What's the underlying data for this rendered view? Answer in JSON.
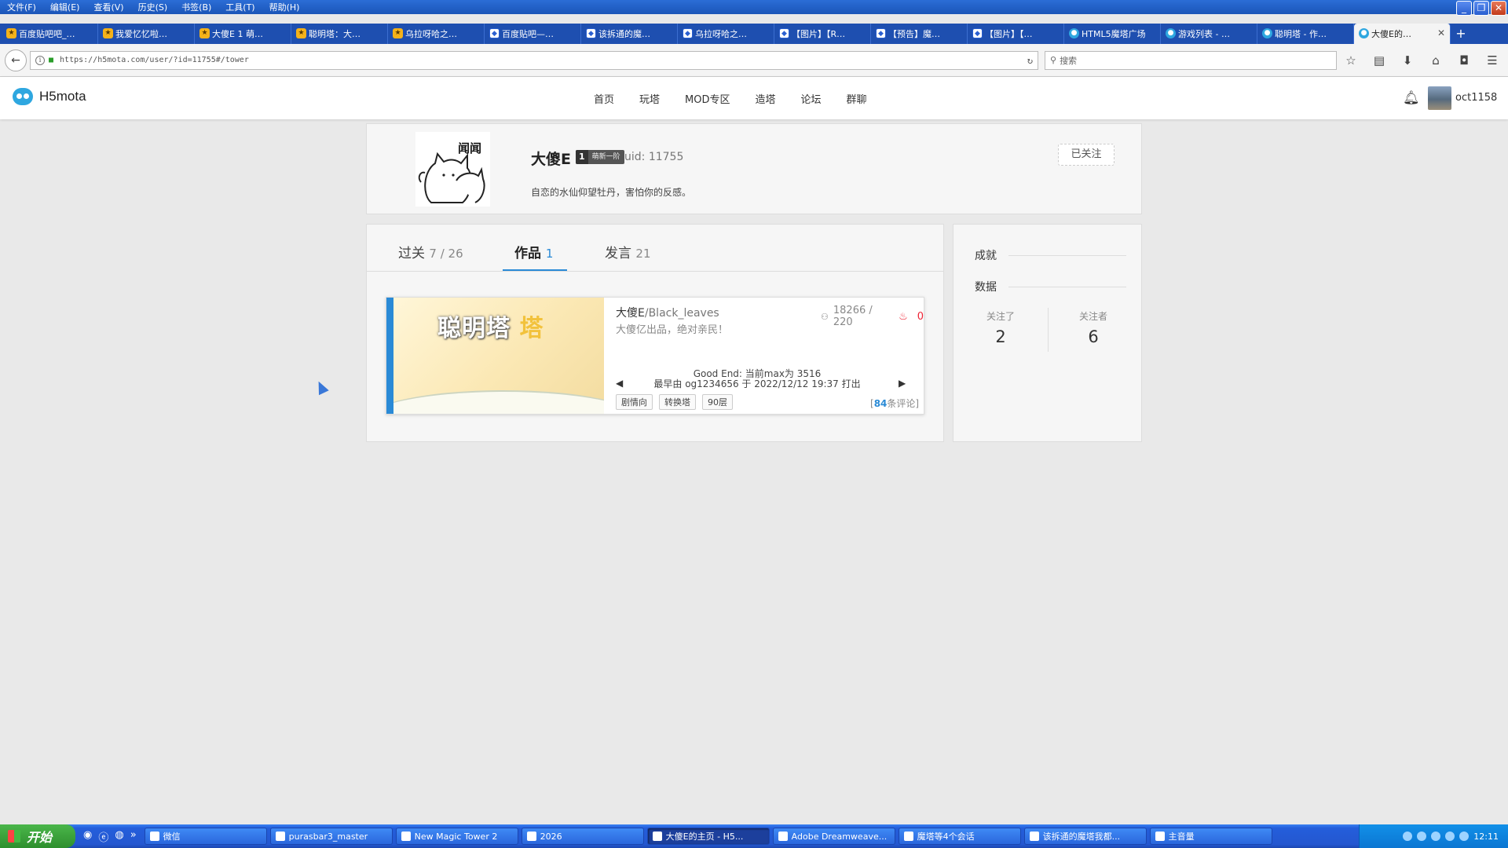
{
  "menubar": {
    "items": [
      "文件(F)",
      "编辑(E)",
      "查看(V)",
      "历史(S)",
      "书签(B)",
      "工具(T)",
      "帮助(H)"
    ]
  },
  "browser_tabs": [
    {
      "label": "百度贴吧吧_…",
      "icon": "bookmark-icon"
    },
    {
      "label": "我爱忆忆啦…",
      "icon": "bookmark-icon"
    },
    {
      "label": "大傻E 1 萌…",
      "icon": "bookmark-icon"
    },
    {
      "label": "聪明塔：大…",
      "icon": "bookmark-icon"
    },
    {
      "label": "乌拉呀哈之…",
      "icon": "bookmark-icon"
    },
    {
      "label": "百度贴吧—…",
      "icon": "baidu-icon"
    },
    {
      "label": "该拆通的魔…",
      "icon": "baidu-icon"
    },
    {
      "label": "乌拉呀哈之…",
      "icon": "baidu-icon"
    },
    {
      "label": "【图片】【R…",
      "icon": "baidu-icon"
    },
    {
      "label": "【预告】魔…",
      "icon": "baidu-icon"
    },
    {
      "label": "【图片】【…",
      "icon": "baidu-icon"
    },
    {
      "label": "HTML5魔塔广场",
      "icon": "h5-icon"
    },
    {
      "label": "游戏列表 - …",
      "icon": "h5-icon"
    },
    {
      "label": "聪明塔 - 作…",
      "icon": "h5-icon"
    },
    {
      "label": "大傻E的…",
      "icon": "h5-icon",
      "active": true
    }
  ],
  "address": {
    "url": "https://h5mota.com/user/?id=11755#/tower",
    "search_placeholder": "搜索"
  },
  "site": {
    "logo": "H5mota",
    "nav": [
      "首页",
      "玩塔",
      "MOD专区",
      "造塔",
      "论坛",
      "群聊"
    ],
    "username": "oct1158"
  },
  "profile": {
    "name": "大傻E",
    "level": "1",
    "level_name": "萌新一阶",
    "uid": "uid: 11755",
    "bio": "自恋的水仙仰望牡丹，害怕你的反感。",
    "follow_button": "已关注",
    "avatar_text": "闻闻"
  },
  "tabs": {
    "clear": {
      "label": "过关",
      "count": "7 / 26"
    },
    "works": {
      "label": "作品",
      "count": "1"
    },
    "posts": {
      "label": "发言",
      "count": "21"
    }
  },
  "tower": {
    "cover_title": "聪明塔",
    "cover_accent": "塔",
    "author": "大傻E",
    "sub": "/Black_leaves",
    "desc": "大傻亿出品，绝对亲民！",
    "players": "18266 / 220",
    "likes": "0",
    "ending_line1": "Good End: 当前max为 3516",
    "ending_line2": "最早由 og1234656 于 2022/12/12 19:37 打出",
    "tags": [
      "剧情向",
      "转换塔",
      "90层"
    ],
    "comments_count": "84",
    "comments_label": "条评论"
  },
  "side": {
    "achievements": "成就",
    "data": "数据",
    "following_label": "关注了",
    "following": "2",
    "followers_label": "关注者",
    "followers": "6"
  },
  "taskbar": {
    "start": "开始",
    "tasks": [
      {
        "label": "微信"
      },
      {
        "label": "purasbar3_master"
      },
      {
        "label": "New Magic Tower 2"
      },
      {
        "label": "2026"
      },
      {
        "label": "大傻E的主页 - H5...",
        "active": true
      },
      {
        "label": "Adobe Dreamweave..."
      },
      {
        "label": "魔塔等4个会话"
      },
      {
        "label": "该拆通的魔塔我都..."
      },
      {
        "label": "主音量"
      }
    ],
    "clock": "12:11"
  },
  "colors": {
    "accent": "#2a8ad6",
    "xp_blue": "#245edb",
    "like_red": "#ee2233"
  }
}
